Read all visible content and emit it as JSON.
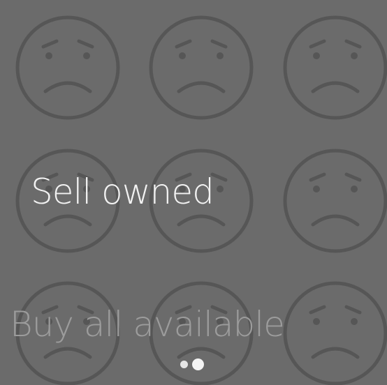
{
  "menu": {
    "items": [
      {
        "label": "Sell owned",
        "state": "selected"
      },
      {
        "label": "Buy all available",
        "state": "unselected"
      }
    ]
  },
  "pager": {
    "page_count": 2,
    "current_page": 2
  },
  "background": {
    "icon": "sad-face-icon",
    "color": "#6b6b6b",
    "pattern_color": "#555555"
  }
}
